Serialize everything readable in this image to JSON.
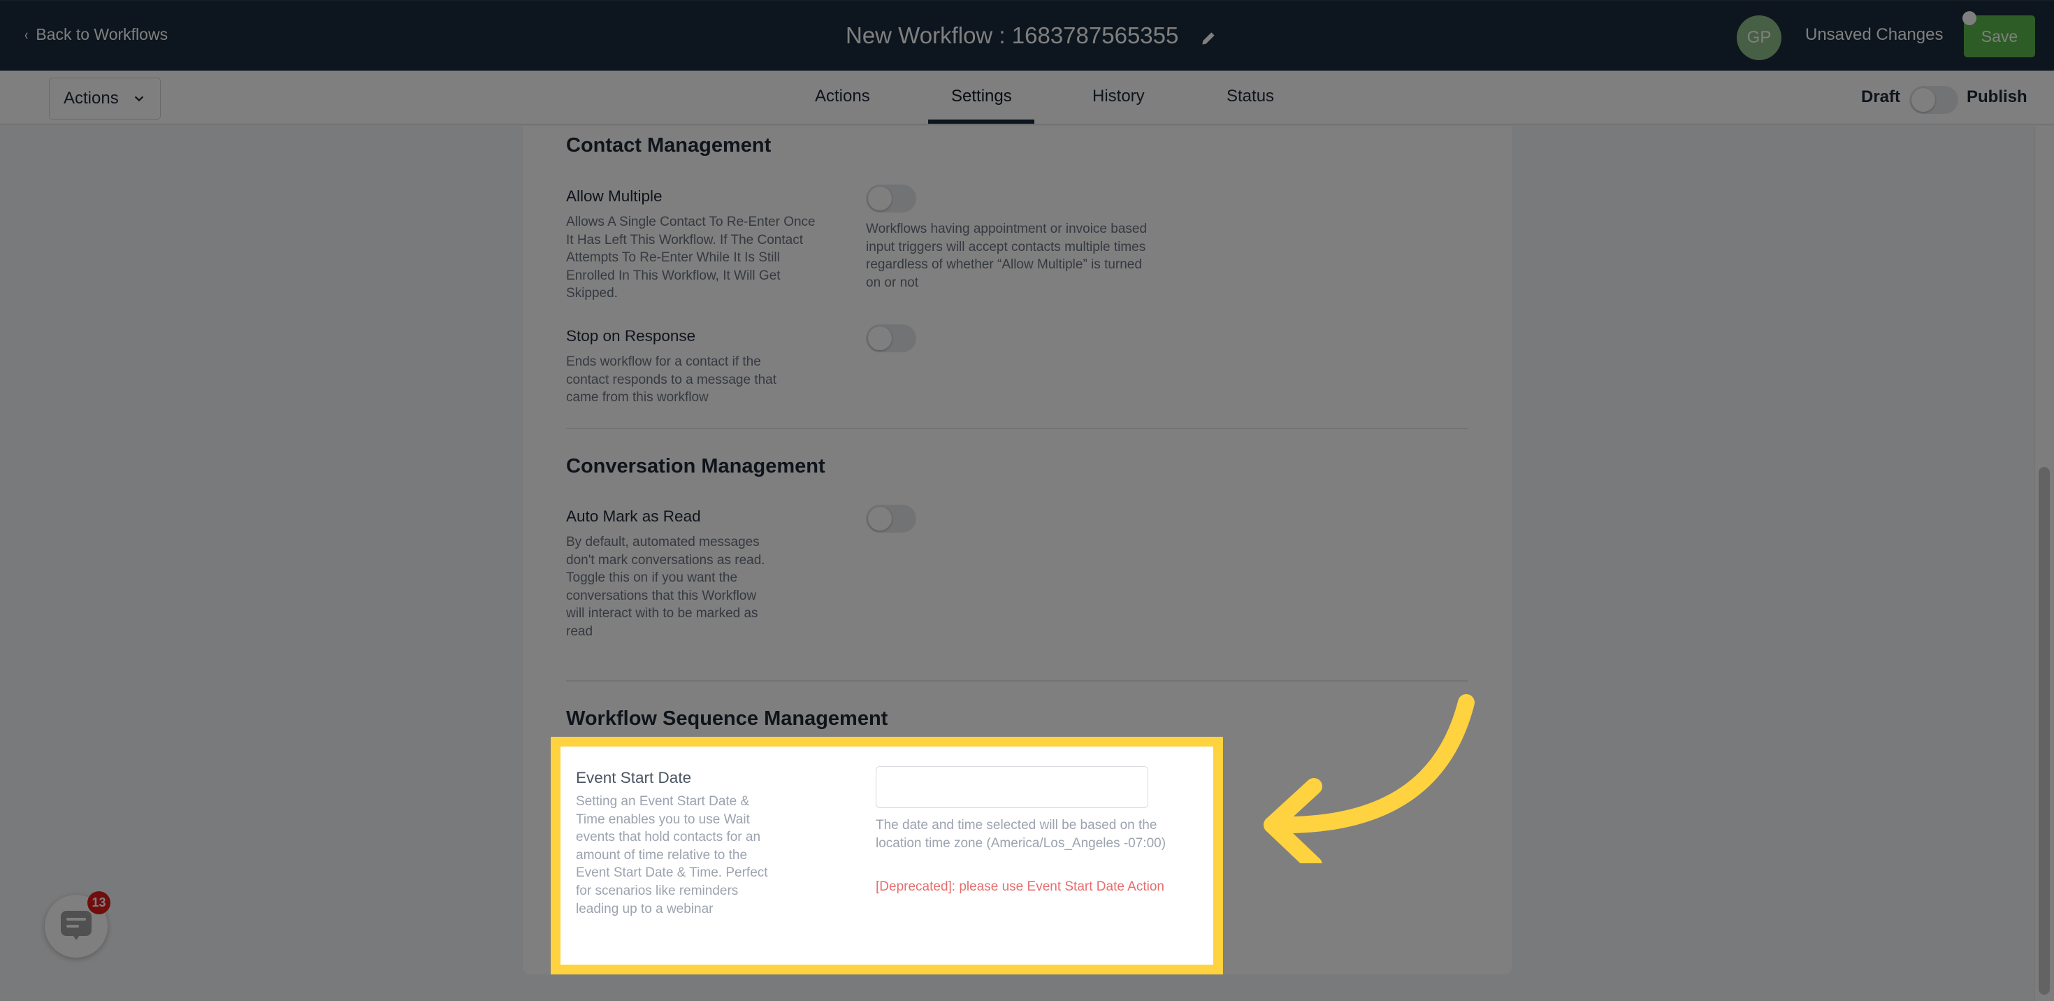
{
  "header": {
    "back_label": "Back to Workflows",
    "title": "New Workflow : 1683787565355",
    "avatar_initials": "GP",
    "status": "Unsaved Changes",
    "save_label": "Save"
  },
  "subnav": {
    "actions_dropdown": "Actions",
    "tabs": [
      {
        "label": "Actions",
        "active": false
      },
      {
        "label": "Settings",
        "active": true
      },
      {
        "label": "History",
        "active": false
      },
      {
        "label": "Status",
        "active": false
      }
    ],
    "draft_label": "Draft",
    "publish_label": "Publish",
    "publish_toggle_on": false
  },
  "sections": {
    "contact": {
      "title": "Contact Management",
      "allow_multiple": {
        "label": "Allow Multiple",
        "description": "Allows A Single Contact To Re-Enter Once It Has Left This Workflow. If The Contact Attempts To Re-Enter While It Is Still Enrolled In This Workflow, It Will Get Skipped.",
        "note": "Workflows having appointment or invoice based input triggers will accept contacts multiple times regardless of whether “Allow Multiple” is turned on or not",
        "enabled": false
      },
      "stop_on_response": {
        "label": "Stop on Response",
        "description": "Ends workflow for a contact if the contact responds to a message that came from this workflow",
        "enabled": false
      }
    },
    "conversation": {
      "title": "Conversation Management",
      "auto_mark_read": {
        "label": "Auto Mark as Read",
        "description": "By default, automated messages don't mark conversations as read. Toggle this on if you want the conversations that this Workflow will interact with to be marked as read",
        "enabled": false
      }
    },
    "sequence": {
      "title": "Workflow Sequence Management",
      "event_start_date": {
        "label": "Event Start Date",
        "description": "Setting an Event Start Date & Time enables you to use Wait events that hold contacts for an amount of time relative to the Event Start Date & Time. Perfect for scenarios like reminders leading up to a webinar",
        "value": "",
        "note": "The date and time selected will be based on the location time zone (America/Los_Angeles -07:00)",
        "warning": "[Deprecated]: please use Event Start Date Action"
      }
    }
  },
  "chat_widget": {
    "badge_count": "13"
  },
  "annotation": {
    "highlight_color": "#ffd23f"
  }
}
